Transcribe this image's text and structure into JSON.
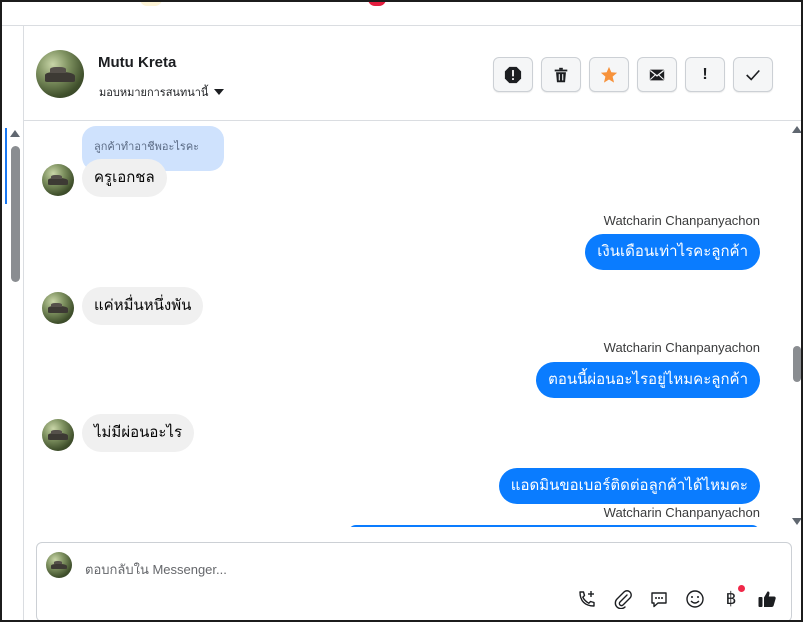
{
  "header": {
    "contact_name": "Mutu Kreta",
    "assign_label": "มอบหมายการสนทนานี้",
    "actions": [
      {
        "name": "report",
        "icon": "alert-octagon-icon"
      },
      {
        "name": "delete",
        "icon": "trash-icon"
      },
      {
        "name": "star",
        "icon": "star-icon",
        "color": "#f7923b"
      },
      {
        "name": "mark-unread",
        "icon": "envelope-icon"
      },
      {
        "name": "important",
        "icon": "exclamation-icon"
      },
      {
        "name": "done",
        "icon": "checkmark-icon"
      }
    ]
  },
  "messages": {
    "quoted_text": "ลูกค้าทำอาชีพอะไรคะ",
    "m1": "ครูเอกชล",
    "sender1": "Watcharin Chanpanyachon",
    "m2": "เงินเดือนเท่าไรคะลูกค้า",
    "m3": "แค่หมื่นหนึ่งพัน",
    "sender2": "Watcharin Chanpanyachon",
    "m4": "ตอนนี้ผ่อนอะไรอยู่ไหมคะลูกค้า",
    "m5": "ไม่มีผ่อนอะไร",
    "m6": "แอดมินขอเบอร์ติดต่อลูกค้าได้ไหมคะ",
    "sender3": "Watcharin Chanpanyachon"
  },
  "composer": {
    "placeholder": "ตอบกลับใน Messenger...",
    "tools": [
      "phone-add-icon",
      "paperclip-icon",
      "chat-bubble-icon",
      "smiley-icon",
      "baht-icon",
      "thumbs-up-icon"
    ],
    "baht_glyph": "฿"
  },
  "colors": {
    "accent": "#0a7cff",
    "quote_bg": "#cfe2fd",
    "incoming_bg": "#f0f0f0",
    "notification_dot": "#f02849"
  }
}
